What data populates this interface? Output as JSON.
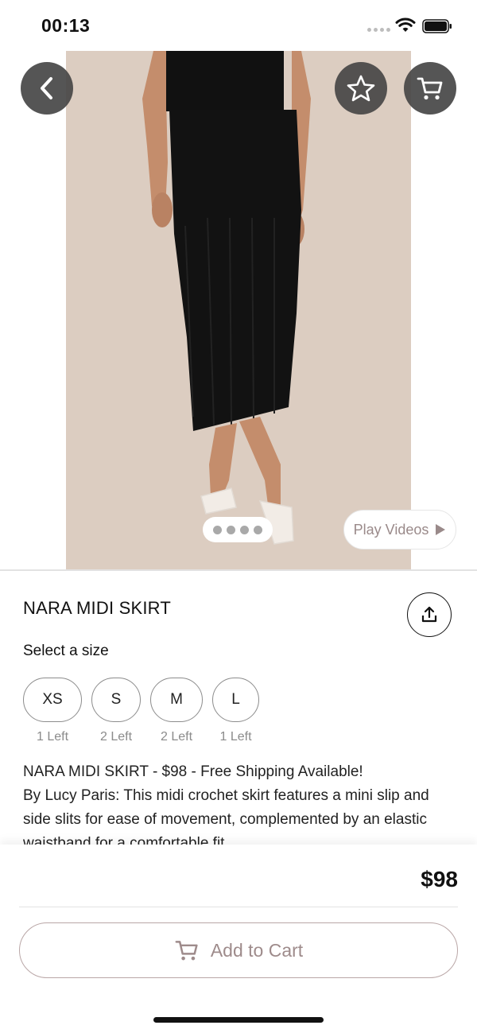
{
  "status_bar": {
    "time": "00:13"
  },
  "product": {
    "title": "NARA MIDI SKIRT",
    "size_heading": "Select a size",
    "sizes": [
      {
        "label": "XS",
        "stock": "1 Left"
      },
      {
        "label": "S",
        "stock": "2 Left"
      },
      {
        "label": "M",
        "stock": "2 Left"
      },
      {
        "label": "L",
        "stock": "1 Left"
      }
    ],
    "description_line1": "NARA MIDI SKIRT - $98 - Free Shipping Available!",
    "description_line2": "By Lucy Paris: This midi crochet skirt features a mini slip and side slits for ease of movement, complemented by an elastic waistband for a comfortable fit."
  },
  "media": {
    "play_videos_label": "Play Videos",
    "image_count": 4,
    "current_image": 1,
    "background_color": "#dccdc1"
  },
  "purchase": {
    "price": "$98",
    "add_to_cart_label": "Add to Cart",
    "accent_color": "#9e8b8b"
  },
  "icons": [
    "chevron-left-icon",
    "star-icon",
    "cart-icon",
    "share-icon",
    "play-icon",
    "wifi-icon",
    "battery-icon"
  ]
}
